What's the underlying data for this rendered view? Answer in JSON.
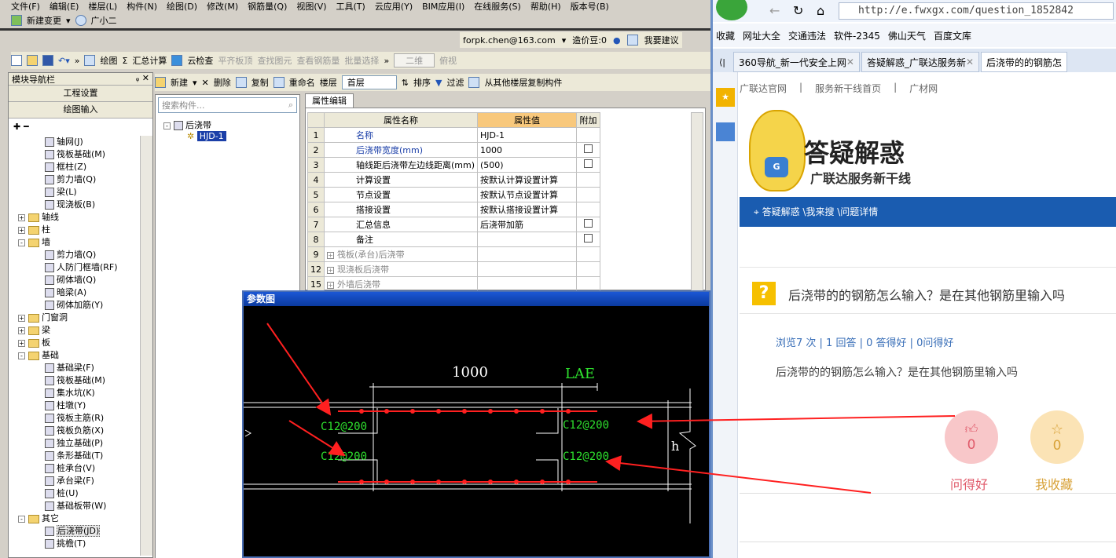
{
  "app": {
    "menu": [
      "文件(F)",
      "编辑(E)",
      "楼层(L)",
      "构件(N)",
      "绘图(D)",
      "修改(M)",
      "钢筋量(Q)",
      "视图(V)",
      "工具(T)",
      "云应用(Y)",
      "BIM应用(I)",
      "在线服务(S)",
      "帮助(H)",
      "版本号(B)"
    ],
    "row2": {
      "new_change": "新建变更",
      "assistant": "广小二"
    },
    "account": {
      "email": "forpk.chen@163.com",
      "beans": "造价豆:0",
      "suggest": "我要建议"
    },
    "toolbar1": [
      "绘图",
      "汇总计算",
      "云检查",
      "平齐板顶",
      "查找图元",
      "查看钢筋量",
      "批量选择",
      "二维",
      "俯视"
    ],
    "nav": {
      "title": "模块导航栏",
      "btn1": "工程设置",
      "btn2": "绘图输入"
    },
    "tree": [
      {
        "label": "轴网(J)",
        "indent": 3,
        "type": "item"
      },
      {
        "label": "筏板基础(M)",
        "indent": 3,
        "type": "item"
      },
      {
        "label": "框柱(Z)",
        "indent": 3,
        "type": "item"
      },
      {
        "label": "剪力墙(Q)",
        "indent": 3,
        "type": "item"
      },
      {
        "label": "梁(L)",
        "indent": 3,
        "type": "item"
      },
      {
        "label": "现浇板(B)",
        "indent": 3,
        "type": "item"
      },
      {
        "label": "轴线",
        "indent": 1,
        "type": "folder",
        "pm": "+"
      },
      {
        "label": "柱",
        "indent": 1,
        "type": "folder",
        "pm": "+"
      },
      {
        "label": "墙",
        "indent": 1,
        "type": "folder",
        "pm": "-"
      },
      {
        "label": "剪力墙(Q)",
        "indent": 3,
        "type": "item"
      },
      {
        "label": "人防门框墙(RF)",
        "indent": 3,
        "type": "item"
      },
      {
        "label": "砌体墙(Q)",
        "indent": 3,
        "type": "item"
      },
      {
        "label": "暗梁(A)",
        "indent": 3,
        "type": "item"
      },
      {
        "label": "砌体加筋(Y)",
        "indent": 3,
        "type": "item"
      },
      {
        "label": "门窗洞",
        "indent": 1,
        "type": "folder",
        "pm": "+"
      },
      {
        "label": "梁",
        "indent": 1,
        "type": "folder",
        "pm": "+"
      },
      {
        "label": "板",
        "indent": 1,
        "type": "folder",
        "pm": "+"
      },
      {
        "label": "基础",
        "indent": 1,
        "type": "folder",
        "pm": "-"
      },
      {
        "label": "基础梁(F)",
        "indent": 3,
        "type": "item"
      },
      {
        "label": "筏板基础(M)",
        "indent": 3,
        "type": "item"
      },
      {
        "label": "集水坑(K)",
        "indent": 3,
        "type": "item"
      },
      {
        "label": "柱墩(Y)",
        "indent": 3,
        "type": "item"
      },
      {
        "label": "筏板主筋(R)",
        "indent": 3,
        "type": "item"
      },
      {
        "label": "筏板负筋(X)",
        "indent": 3,
        "type": "item"
      },
      {
        "label": "独立基础(P)",
        "indent": 3,
        "type": "item"
      },
      {
        "label": "条形基础(T)",
        "indent": 3,
        "type": "item"
      },
      {
        "label": "桩承台(V)",
        "indent": 3,
        "type": "item"
      },
      {
        "label": "承台梁(F)",
        "indent": 3,
        "type": "item"
      },
      {
        "label": "桩(U)",
        "indent": 3,
        "type": "item"
      },
      {
        "label": "基础板带(W)",
        "indent": 3,
        "type": "item"
      },
      {
        "label": "其它",
        "indent": 1,
        "type": "folder",
        "pm": "-"
      },
      {
        "label": "后浇带(JD)",
        "indent": 3,
        "type": "item",
        "selected": true
      },
      {
        "label": "挑檐(T)",
        "indent": 3,
        "type": "item"
      }
    ],
    "toolbar2": {
      "new": "新建",
      "delete": "删除",
      "copy": "复制",
      "rename": "重命名",
      "floor_label": "楼层",
      "floor_value": "首层",
      "sort": "排序",
      "filter": "过滤",
      "copy_from": "从其他楼层复制构件"
    },
    "search_placeholder": "搜索构件...",
    "component_tree": {
      "root": "后浇带",
      "child": "HJD-1"
    },
    "prop_tab": "属性编辑",
    "prop_headers": [
      "属性名称",
      "属性值",
      "附加"
    ],
    "props": [
      {
        "n": "1",
        "name": "名称",
        "value": "HJD-1",
        "blue": true,
        "cb": false,
        "exp": false
      },
      {
        "n": "2",
        "name": "后浇带宽度(mm)",
        "value": "1000",
        "blue": true,
        "cb": true,
        "exp": false
      },
      {
        "n": "3",
        "name": "轴线距后浇带左边线距离(mm)",
        "value": "(500)",
        "blue": false,
        "cb": true,
        "exp": false
      },
      {
        "n": "4",
        "name": "计算设置",
        "value": "按默认计算设置计算",
        "blue": false,
        "cb": false,
        "exp": false
      },
      {
        "n": "5",
        "name": "节点设置",
        "value": "按默认节点设置计算",
        "blue": false,
        "cb": false,
        "exp": false
      },
      {
        "n": "6",
        "name": "搭接设置",
        "value": "按默认搭接设置计算",
        "blue": false,
        "cb": false,
        "exp": false
      },
      {
        "n": "7",
        "name": "汇总信息",
        "value": "后浇带加筋",
        "blue": false,
        "cb": true,
        "exp": false
      },
      {
        "n": "8",
        "name": "备注",
        "value": "",
        "blue": false,
        "cb": true,
        "exp": false
      },
      {
        "n": "9",
        "name": "筏板(承台)后浇带",
        "value": "",
        "blue": false,
        "cb": false,
        "exp": true
      },
      {
        "n": "12",
        "name": "现浇板后浇带",
        "value": "",
        "blue": false,
        "cb": false,
        "exp": true
      },
      {
        "n": "15",
        "name": "外墙后浇带",
        "value": "",
        "blue": false,
        "cb": false,
        "exp": true
      }
    ],
    "dialog": {
      "title": "参数图",
      "dim_width": "1000",
      "dim_lae": "LAE",
      "rebar_tl": "C12@200",
      "rebar_bl": "C12@200",
      "rebar_tr": "C12@200",
      "rebar_br": "C12@200",
      "h_label": "h"
    }
  },
  "browser": {
    "url": "http://e.fwxgx.com/question_1852842",
    "favs": [
      "收藏",
      "网址大全",
      "交通违法",
      "软件-2345",
      "佛山天气",
      "百度文库"
    ],
    "tabs": [
      "360导航_新一代安全上网",
      "答疑解惑_广联达服务新",
      "后浇带的的钢筋怎"
    ],
    "site_nav": [
      "广联达官网",
      "服务新干线首页",
      "广材网"
    ],
    "logo_title": "答疑解惑",
    "logo_sub": "广联达服务新干线",
    "logo_badge": "G",
    "crumb": "答疑解惑 \\我来搜 \\问题详情",
    "question_title": "后浇带的的钢筋怎么输入？是在其他钢筋里输入吗",
    "stats": "浏览7 次 | 1 回答 | 0 答得好 | 0问得好",
    "question_body": "后浇带的的钢筋怎么输入？是在其他钢筋里输入吗",
    "like": {
      "count": "0",
      "label": "问得好"
    },
    "fav": {
      "count": "0",
      "label": "我收藏"
    },
    "colors": {
      "brand_blue": "#1a5cb0",
      "like_pink": "#f8c7c9",
      "fav_yellow": "#fbe3b5",
      "q_icon": "#f6c000"
    }
  }
}
